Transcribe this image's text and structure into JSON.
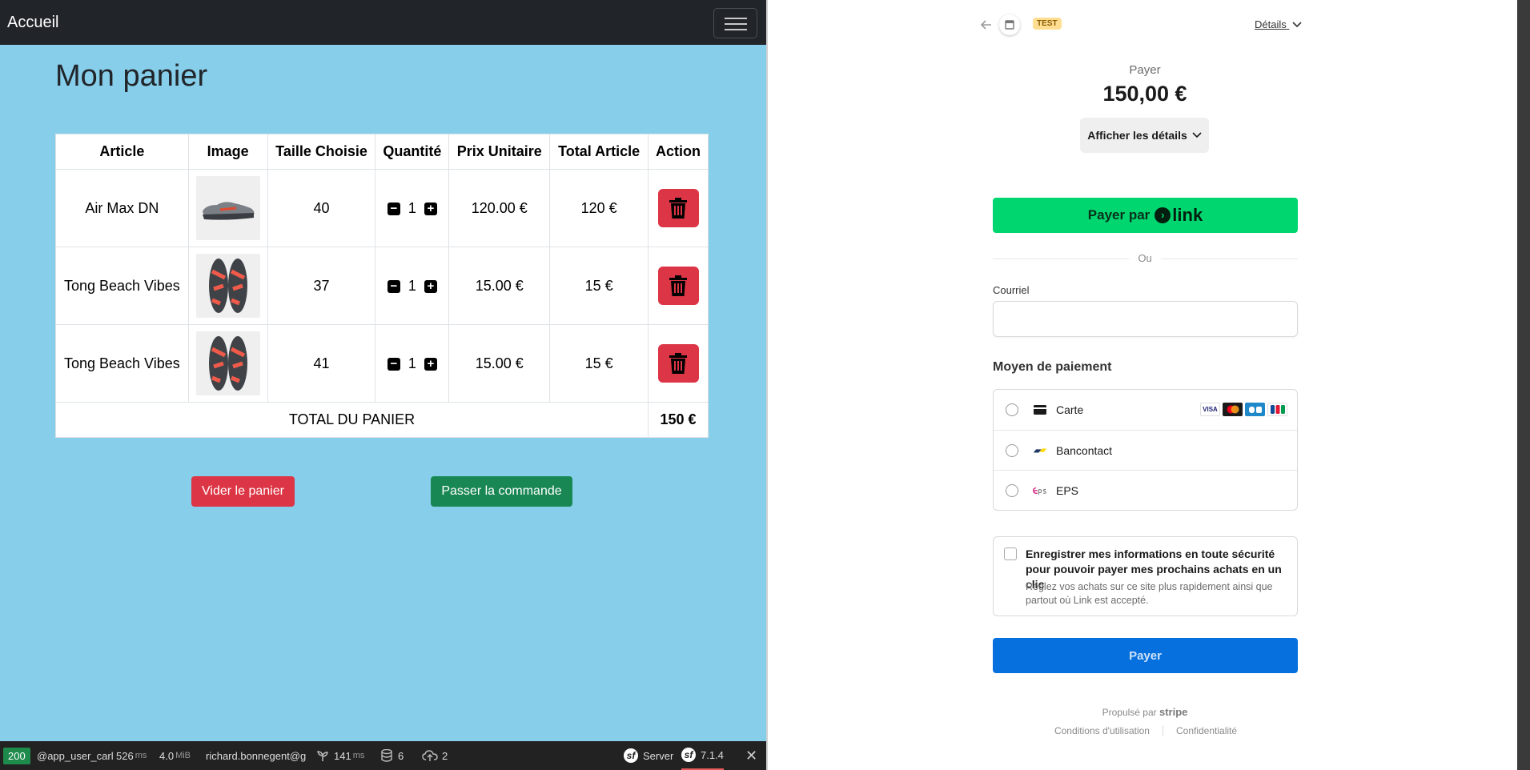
{
  "nav": {
    "brand": "Accueil"
  },
  "cart": {
    "title": "Mon panier",
    "headers": [
      "Article",
      "Image",
      "Taille Choisie",
      "Quantité",
      "Prix Unitaire",
      "Total Article",
      "Action"
    ],
    "rows": [
      {
        "article": "Air Max DN",
        "image_icon": "sneaker-image",
        "size": "40",
        "qty": "1",
        "unit_price": "120.00 €",
        "total": "120 €"
      },
      {
        "article": "Tong Beach Vibes",
        "image_icon": "flip-flop-image",
        "size": "37",
        "qty": "1",
        "unit_price": "15.00 €",
        "total": "15 €"
      },
      {
        "article": "Tong Beach Vibes",
        "image_icon": "flip-flop-image",
        "size": "41",
        "qty": "1",
        "unit_price": "15.00 €",
        "total": "15 €"
      }
    ],
    "total_label": "TOTAL DU PANIER",
    "total_value": "150 €",
    "empty_button": "Vider le panier",
    "order_button": "Passer la commande"
  },
  "debugbar": {
    "status": "200",
    "route": "@app_user_carl",
    "time": "526",
    "time_unit": "ms",
    "memory": "4.0",
    "memory_unit": "MiB",
    "user": "richard.bonnegent@g",
    "render_time": "141",
    "render_unit": "ms",
    "db_queries": "6",
    "uploads": "2",
    "server": "Server",
    "version": "7.1.4"
  },
  "checkout": {
    "test_badge": "TEST",
    "details_link": "Détails",
    "pay_label": "Payer",
    "amount": "150,00 €",
    "show_details": "Afficher les détails",
    "link_prefix": "Payer par",
    "link_brand": "link",
    "or": "Ou",
    "email_label": "Courriel",
    "email_value": "",
    "payment_method_title": "Moyen de paiement",
    "methods": [
      {
        "label": "Carte",
        "icon": "card-icon"
      },
      {
        "label": "Bancontact",
        "icon": "bancontact-icon"
      },
      {
        "label": "EPS",
        "icon": "eps-icon"
      }
    ],
    "card_brands": [
      "VISA",
      "mastercard",
      "cb",
      "JCB"
    ],
    "save_title": "Enregistrer mes informations en toute sécurité pour pouvoir payer mes prochains achats en un clic",
    "save_subtitle": "Réglez vos achats sur ce site plus rapidement ainsi que partout où Link est accepté.",
    "pay_button": "Payer",
    "powered_by": "Propulsé par",
    "powered_brand": "stripe",
    "terms": "Conditions d'utilisation",
    "privacy": "Confidentialité"
  },
  "colors": {
    "page_bg": "#87ceeb",
    "navbar": "#212529",
    "danger": "#dc3545",
    "success": "#198754",
    "link_green": "#00d66f",
    "stripe_blue": "#0570de"
  }
}
